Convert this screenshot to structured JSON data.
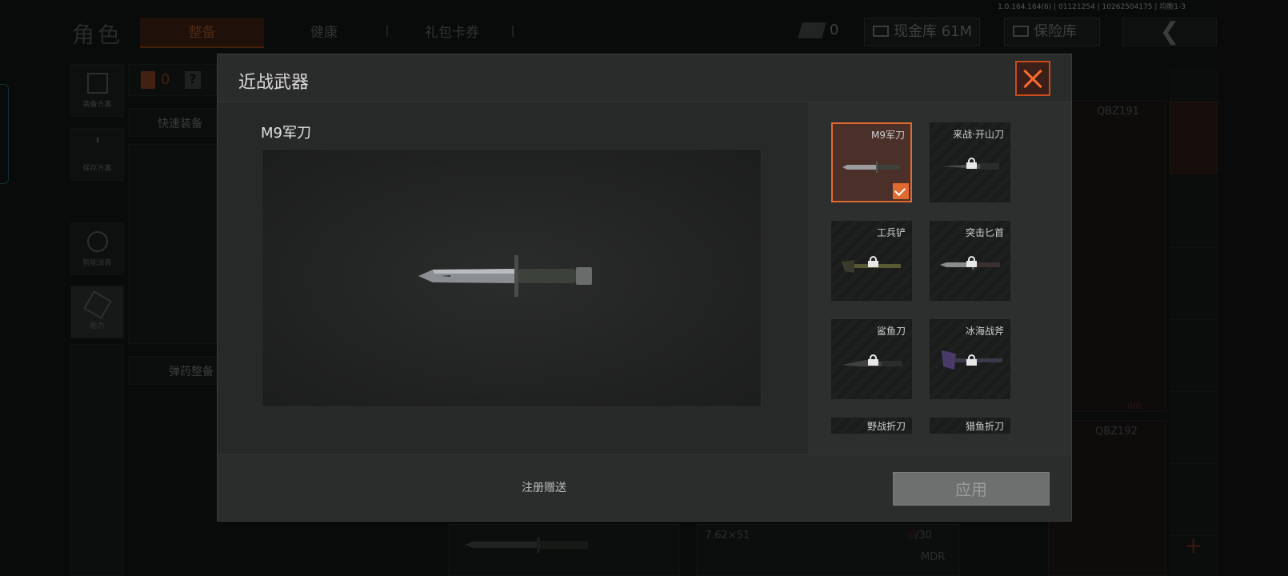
{
  "version": "1.0.164.164(6) | 01121254 | 10262504175 | 均衡1-3",
  "header": {
    "title": "角色",
    "tabs": [
      {
        "label": "整备",
        "active": true
      },
      {
        "label": "健康",
        "active": false
      },
      {
        "label": "礼包卡券",
        "active": false
      }
    ],
    "currency_count": "0",
    "cash_vault": "现金库 61M",
    "safe_box": "保险库"
  },
  "sidebar": {
    "items": [
      {
        "label": "装备方案",
        "icon": "vest-icon"
      },
      {
        "label": "保存方案",
        "icon": "download-icon"
      },
      {
        "label": "智能涂装",
        "icon": "helmet-icon"
      },
      {
        "label": "能力",
        "icon": "energy-icon"
      }
    ]
  },
  "loadout": {
    "armor_count": "0",
    "help": "?",
    "quick_equip": "快速装备",
    "ammo_manage": "弹药整备",
    "weapon_1": "QBZ191",
    "weapon_2": "QBZ192",
    "ammo_type": "7.62×51",
    "ammo_count_left": "0",
    "ammo_count_right": "/30",
    "ammo_label": "MDR",
    "status_left": "0/0"
  },
  "modal": {
    "title": "近战武器",
    "selected_name": "M9军刀",
    "footer_text": "注册赠送",
    "apply_label": "应用",
    "weapons": [
      {
        "label": "M9军刀",
        "locked": false,
        "selected": true
      },
      {
        "label": "来战·开山刀",
        "locked": true,
        "selected": false
      },
      {
        "label": "工兵铲",
        "locked": true,
        "selected": false
      },
      {
        "label": "突击匕首",
        "locked": true,
        "selected": false
      },
      {
        "label": "鲨鱼刀",
        "locked": true,
        "selected": false
      },
      {
        "label": "冰海战斧",
        "locked": true,
        "selected": false
      },
      {
        "label": "野战折刀",
        "locked": true,
        "selected": false
      },
      {
        "label": "猎鱼折刀",
        "locked": true,
        "selected": false
      }
    ]
  },
  "colors": {
    "accent": "#e06a30",
    "close": "#ff6a2c"
  }
}
